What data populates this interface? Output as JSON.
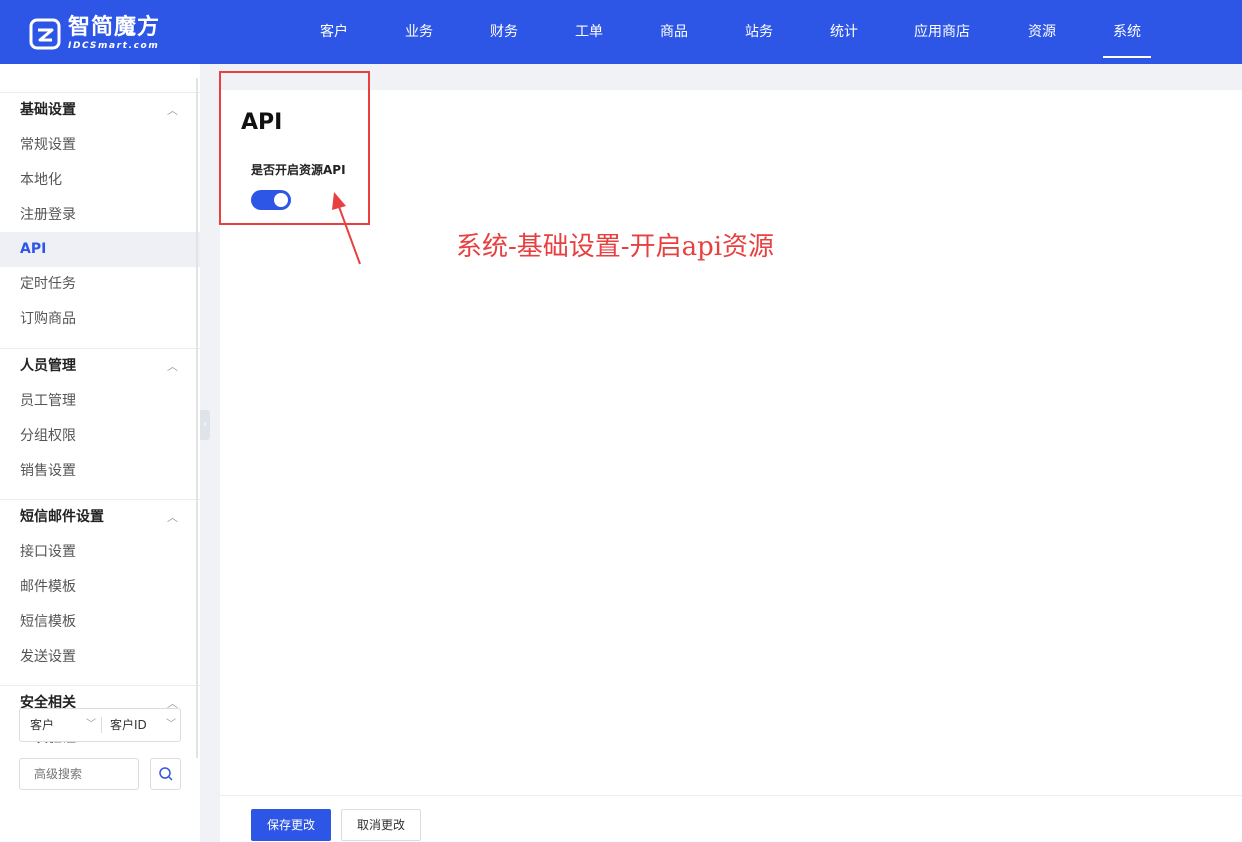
{
  "header": {
    "brand": {
      "name": "智简魔方",
      "sub": "IDCSmart.com"
    },
    "nav": [
      {
        "label": "客户"
      },
      {
        "label": "业务"
      },
      {
        "label": "财务"
      },
      {
        "label": "工单"
      },
      {
        "label": "商品"
      },
      {
        "label": "站务"
      },
      {
        "label": "统计"
      },
      {
        "label": "应用商店"
      },
      {
        "label": "资源"
      },
      {
        "label": "系统",
        "active": true
      }
    ]
  },
  "sidebar": {
    "groups": [
      {
        "title": "基础设置",
        "items": [
          "常规设置",
          "本地化",
          "注册登录",
          "API",
          "定时任务",
          "订购商品"
        ]
      },
      {
        "title": "人员管理",
        "items": [
          "员工管理",
          "分组权限",
          "销售设置"
        ]
      },
      {
        "title": "短信邮件设置",
        "items": [
          "接口设置",
          "邮件模板",
          "短信模板",
          "发送设置"
        ]
      },
      {
        "title": "安全相关",
        "items": [
          "二次验证"
        ]
      }
    ],
    "active_item": "API",
    "filter": {
      "type_select": "客户",
      "field_select": "客户ID"
    },
    "search": {
      "placeholder": "高级搜索"
    }
  },
  "main": {
    "title": "API",
    "field_label": "是否开启资源API",
    "toggle_on": true
  },
  "footer": {
    "save_label": "保存更改",
    "cancel_label": "取消更改"
  },
  "annotation": {
    "text": "系统-基础设置-开启api资源",
    "color": "#e84040"
  },
  "colors": {
    "brand": "#2e56e6",
    "annotation": "#e84040"
  }
}
